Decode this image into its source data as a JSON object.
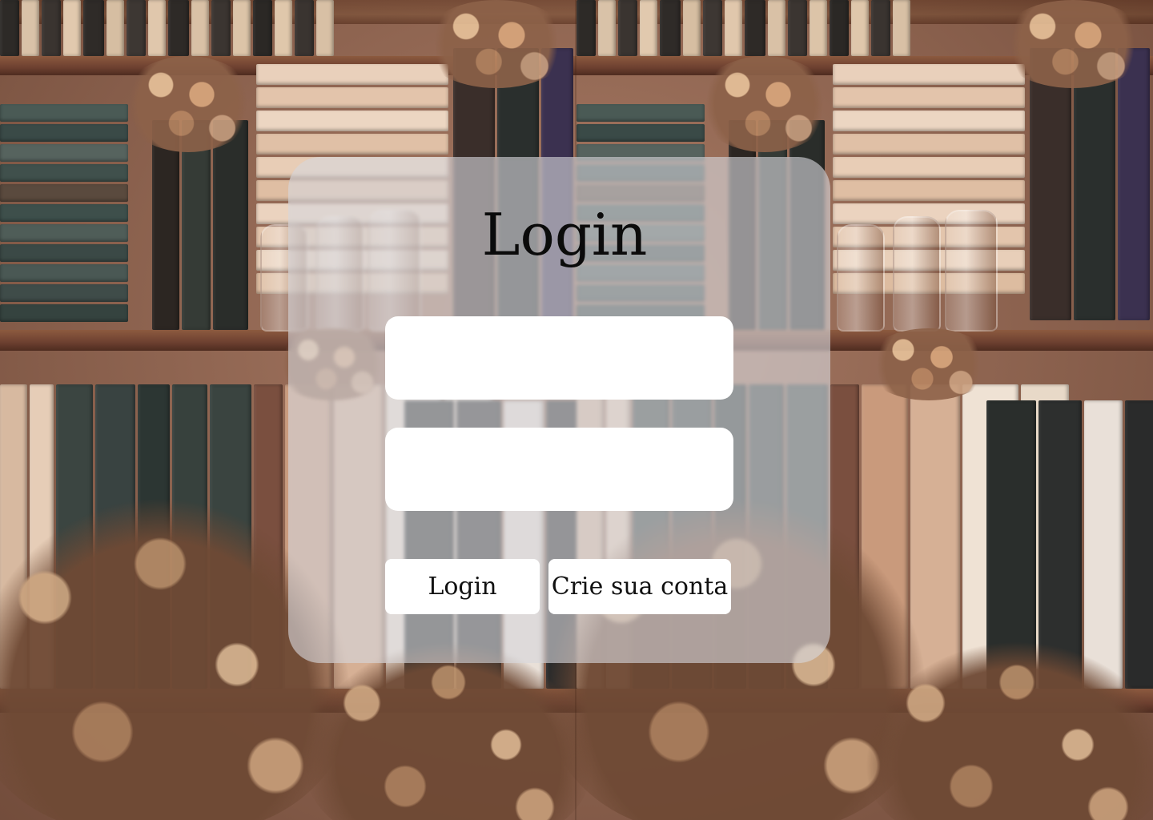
{
  "page": {
    "title": "Login"
  },
  "form": {
    "username": {
      "value": "",
      "placeholder": ""
    },
    "password": {
      "value": "",
      "placeholder": ""
    },
    "login_button_label": "Login",
    "create_account_button_label": "Crie sua conta"
  },
  "colors": {
    "panel_background": "#d7d7dc",
    "field_background": "#ffffff",
    "title_text": "#0b0b0b"
  }
}
